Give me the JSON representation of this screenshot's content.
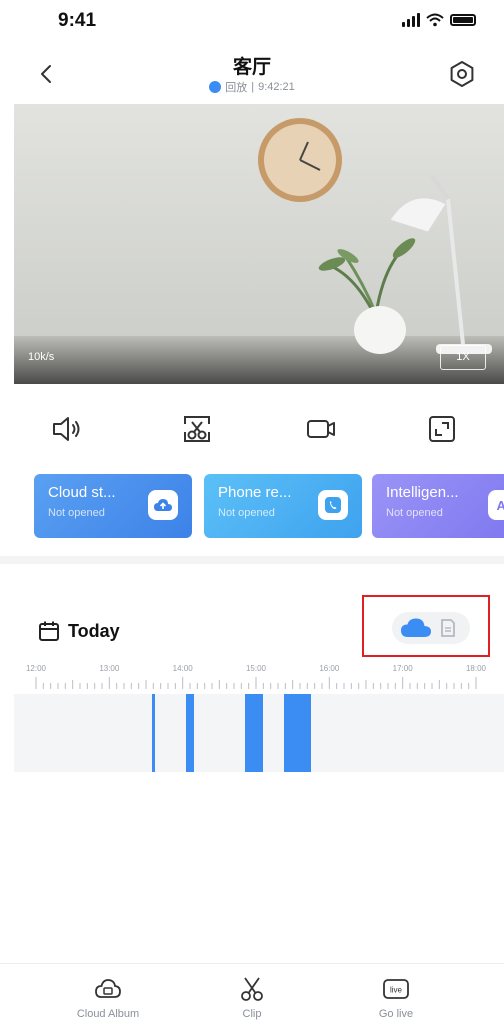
{
  "status_bar": {
    "time": "9:41"
  },
  "header": {
    "title": "客厅",
    "playback_label": "回放",
    "playback_time": "9:42:21"
  },
  "video": {
    "bitrate": "10k/s",
    "zoom": "1X"
  },
  "controls": [
    {
      "icon": "speaker-icon"
    },
    {
      "icon": "screenshot-icon"
    },
    {
      "icon": "record-icon"
    },
    {
      "icon": "fullscreen-icon"
    }
  ],
  "cards": [
    {
      "title": "Cloud st...",
      "subtitle": "Not opened",
      "icon": "cloud-upload-icon",
      "color": "#4a90ee"
    },
    {
      "title": "Phone re...",
      "subtitle": "Not opened",
      "icon": "phone-icon",
      "color": "#4db2f5"
    },
    {
      "title": "Intelligen...",
      "subtitle": "Not opened",
      "badge": "AI",
      "icon": "ai-icon",
      "color": "#8b86f5"
    }
  ],
  "timeline": {
    "title": "Today",
    "labels": [
      "12:00",
      "13:00",
      "14:00",
      "15:00",
      "16:00",
      "17:00",
      "18:00"
    ],
    "segments_hours": [
      [
        13.58,
        13.62
      ],
      [
        14.05,
        14.15
      ],
      [
        14.85,
        15.1
      ],
      [
        15.38,
        15.75
      ]
    ]
  },
  "bottom_bar": {
    "tabs": [
      {
        "label": "Cloud Album",
        "icon": "cloud-album-icon"
      },
      {
        "label": "Clip",
        "icon": "scissors-icon"
      },
      {
        "label": "Go live",
        "icon": "live-icon",
        "icon_text": "live"
      }
    ]
  },
  "colors": {
    "accent": "#3b8cf3",
    "highlight": "#e02020"
  }
}
